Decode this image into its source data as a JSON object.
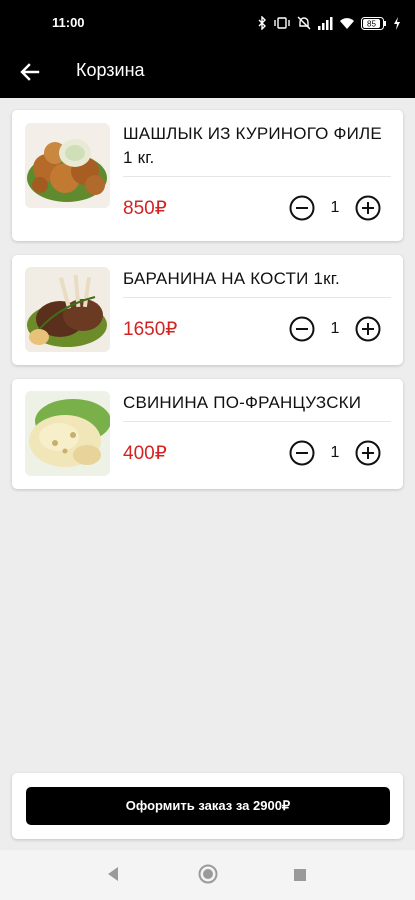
{
  "status_bar": {
    "time": "11:00",
    "icons": [
      "bluetooth-icon",
      "vibrate-icon",
      "alarm-off-icon",
      "signal-icon",
      "wifi-icon",
      "battery-icon",
      "charging-icon"
    ],
    "battery_level": "85"
  },
  "app_bar": {
    "back_icon": "arrow-left-icon",
    "title": "Корзина"
  },
  "cart": {
    "items": [
      {
        "name": "ШАШЛЫК ИЗ КУРИНОГО ФИЛЕ 1 кг.",
        "price": "850₽",
        "quantity": "1",
        "image": "chicken-shashlik-photo"
      },
      {
        "name": "БАРАНИНА НА КОСТИ 1кг.",
        "price": "1650₽",
        "quantity": "1",
        "image": "lamb-ribs-photo"
      },
      {
        "name": "СВИНИНА ПО-ФРАНЦУЗСКИ",
        "price": "400₽",
        "quantity": "1",
        "image": "french-pork-photo"
      }
    ]
  },
  "checkout": {
    "button_label": "Оформить заказ за 2900₽"
  },
  "colors": {
    "price": "#d32323",
    "header_bg": "#000000",
    "page_bg": "#ededed"
  },
  "nav_bar": {
    "icons": [
      "back-triangle-icon",
      "home-circle-icon",
      "recents-square-icon"
    ]
  }
}
